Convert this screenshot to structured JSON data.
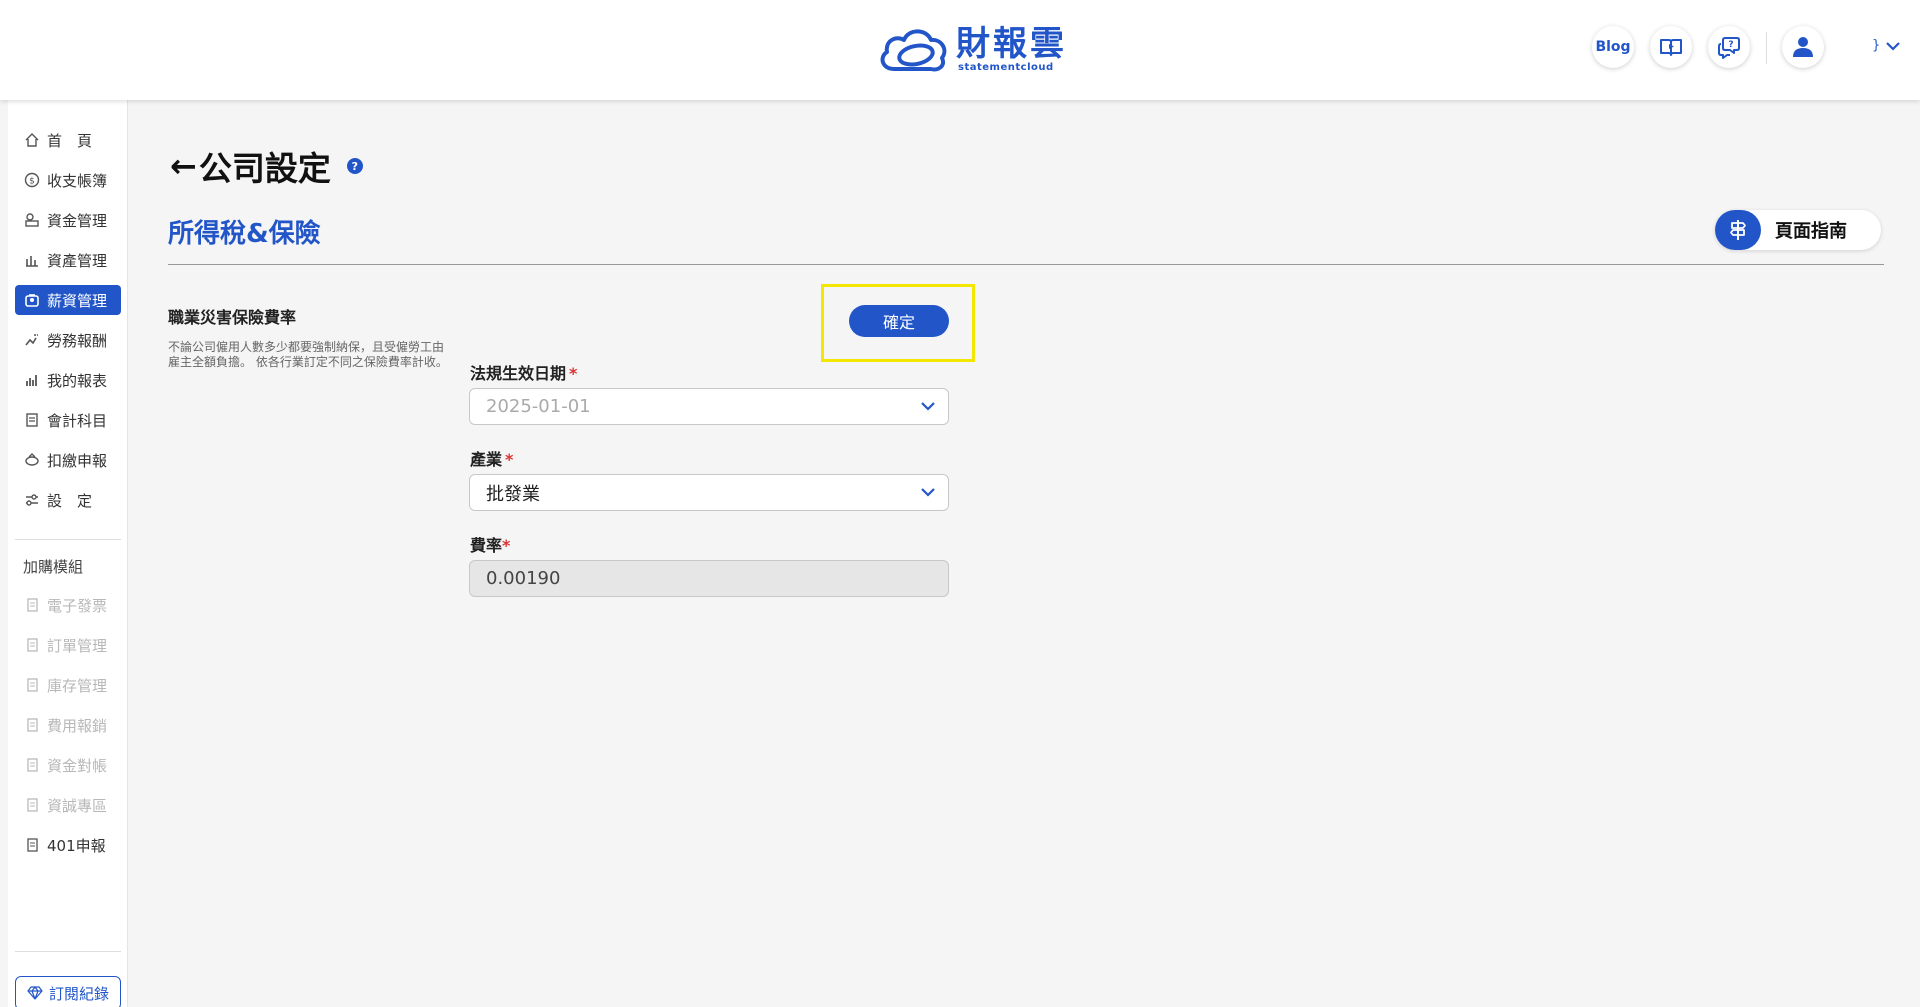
{
  "header": {
    "logo_main": "財報雲",
    "logo_sub": "statementcloud",
    "blog_label": "Blog",
    "user_suffix": "}"
  },
  "sidebar": {
    "items": [
      {
        "label": "首　頁",
        "icon": "home-icon"
      },
      {
        "label": "收支帳簿",
        "icon": "coin-icon"
      },
      {
        "label": "資金管理",
        "icon": "cash-icon"
      },
      {
        "label": "資產管理",
        "icon": "asset-icon"
      },
      {
        "label": "薪資管理",
        "icon": "salary-icon",
        "active": true
      },
      {
        "label": "勞務報酬",
        "icon": "handshake-icon"
      },
      {
        "label": "我的報表",
        "icon": "chart-icon"
      },
      {
        "label": "會計科目",
        "icon": "ledger-icon"
      },
      {
        "label": "扣繳申報",
        "icon": "tax-icon"
      },
      {
        "label": "設　定",
        "icon": "settings-icon"
      }
    ],
    "addon_section": "加購模組",
    "addons": [
      {
        "label": "電子發票",
        "disabled": true
      },
      {
        "label": "訂單管理",
        "disabled": true
      },
      {
        "label": "庫存管理",
        "disabled": true
      },
      {
        "label": "費用報銷",
        "disabled": true
      },
      {
        "label": "資金對帳",
        "disabled": true
      },
      {
        "label": "資誠專區",
        "disabled": true
      },
      {
        "label": "401申報",
        "disabled": false
      }
    ],
    "subscription": "訂閱紀錄"
  },
  "main": {
    "back_arrow": "←",
    "page_title": "公司設定",
    "help_mark": "?",
    "section_title": "所得稅&保險",
    "guide_label": "頁面指南",
    "field_title": "職業災害保險費率",
    "field_desc": "不論公司僱用人數多少都要強制納保，且受僱勞工由雇主全額負擔。 依各行業訂定不同之保險費率計收。",
    "confirm_label": "確定",
    "form": {
      "date_label": "法規生效日期",
      "date_value": "2025-01-01",
      "industry_label": "產業",
      "industry_value": "批發業",
      "rate_label": "費率",
      "rate_value": "0.00190",
      "required_mark": "*"
    }
  },
  "colors": {
    "accent": "#2256c8",
    "highlight": "#f3e600",
    "required": "#dd3333"
  }
}
